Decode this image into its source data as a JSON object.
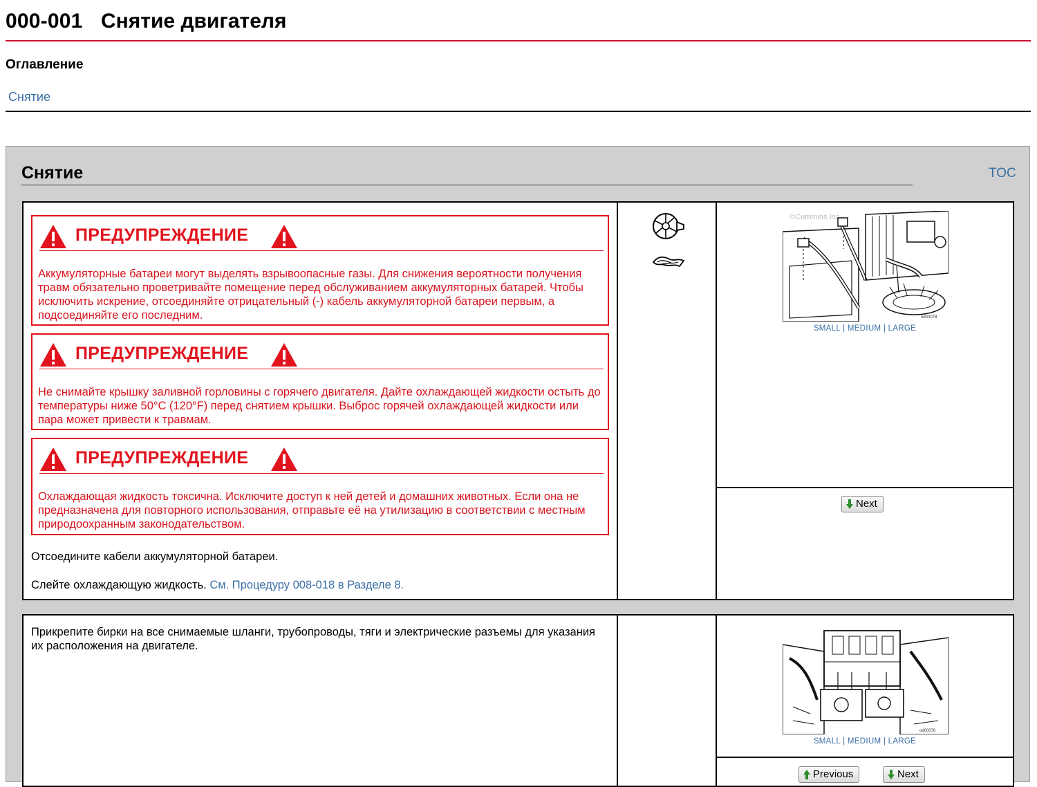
{
  "header": {
    "doc_number": "000-001",
    "title": "Снятие двигателя"
  },
  "toc": {
    "heading": "Оглавление",
    "links": [
      "Снятие"
    ]
  },
  "section": {
    "title": "Снятие",
    "toc_link": "TOC"
  },
  "steps": [
    {
      "warnings": [
        {
          "title": "ПРЕДУПРЕЖДЕНИЕ",
          "text": "Аккумуляторные батареи могут выделять взрывоопасные газы. Для снижения вероятности получения травм обязательно проветривайте помещение перед обслуживанием аккумуляторных батарей. Чтобы исключить искрение, отсоединяйте отрицательный (-) кабель аккумуляторной батареи первым, а подсоединяйте его последним."
        },
        {
          "title": "ПРЕДУПРЕЖДЕНИЕ",
          "text": "Не снимайте крышку заливной горловины с горячего двигателя. Дайте охлаждающей жидкости остыть до температуры ниже 50°C (120°F) перед снятием крышки. Выброс горячей охлаждающей жидкости или пара может привести к травмам."
        },
        {
          "title": "ПРЕДУПРЕЖДЕНИЕ",
          "text": "Охлаждающая жидкость токсична. Исключите доступ к ней детей и домашних животных. Если она не предназначена для повторного использования, отправьте её на утилизацию в соответствии с местным природоохранным законодательством."
        }
      ],
      "instruction_1": "Отсоедините кабели аккумуляторной батареи.",
      "instruction_2": "Слейте охлаждающую жидкость.",
      "instruction_2_link": "См. Процедуру 008-018 в Разделе 8.",
      "icons": [
        "wrench-socket-icon",
        "wiping-cloth-icon"
      ],
      "figure": {
        "watermark": "©Cummins Inc.",
        "size_links": [
          "SMALL",
          "MEDIUM",
          "LARGE"
        ]
      },
      "nav": {
        "next_label": "Next"
      }
    },
    {
      "instruction_1": "Прикрепите бирки на все снимаемые шланги, трубопроводы, тяги и электрические разъемы для указания их расположения на двигателе.",
      "figure": {
        "size_links": [
          "SMALL",
          "MEDIUM",
          "LARGE"
        ]
      },
      "nav": {
        "previous_label": "Previous",
        "next_label": "Next"
      }
    }
  ],
  "colors": {
    "warning_red": "#e1141e",
    "link_blue": "#3a6ea5",
    "header_rule": "#c8102e",
    "panel_gray": "#d0d0d0"
  }
}
